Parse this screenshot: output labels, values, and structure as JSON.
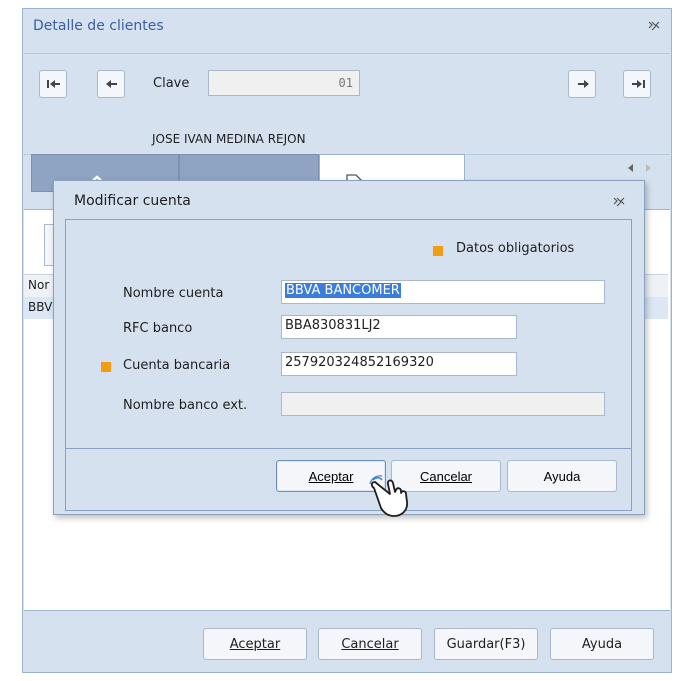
{
  "window": {
    "title": "Detalle de clientes"
  },
  "nav": {
    "clave_label": "Clave",
    "clave_value": "01",
    "customer_name": "JOSE IVAN MEDINA REJON"
  },
  "grid": {
    "header": "Nor",
    "row1": "BBV"
  },
  "footer": {
    "aceptar": "Aceptar",
    "cancelar": "Cancelar",
    "guardar": "Guardar(F3)",
    "ayuda": "Ayuda"
  },
  "modal": {
    "title": "Modificar cuenta",
    "required_label": "Datos obligatorios",
    "fields": {
      "nombre_cuenta_label": "Nombre cuenta",
      "nombre_cuenta_value": "BBVA BANCOMER",
      "rfc_label": "RFC banco",
      "rfc_value": "BBA830831LJ2",
      "cuenta_label": "Cuenta bancaria",
      "cuenta_value": "257920324852169320",
      "banco_ext_label": "Nombre banco ext.",
      "banco_ext_value": ""
    },
    "buttons": {
      "aceptar": "Aceptar",
      "cancelar": "Cancelar",
      "ayuda": "Ayuda"
    }
  },
  "colors": {
    "window_bg": "#d6e1ef",
    "title_text": "#3b5ea0",
    "required_marker": "#f39c12",
    "selection": "#3b7ddb"
  }
}
